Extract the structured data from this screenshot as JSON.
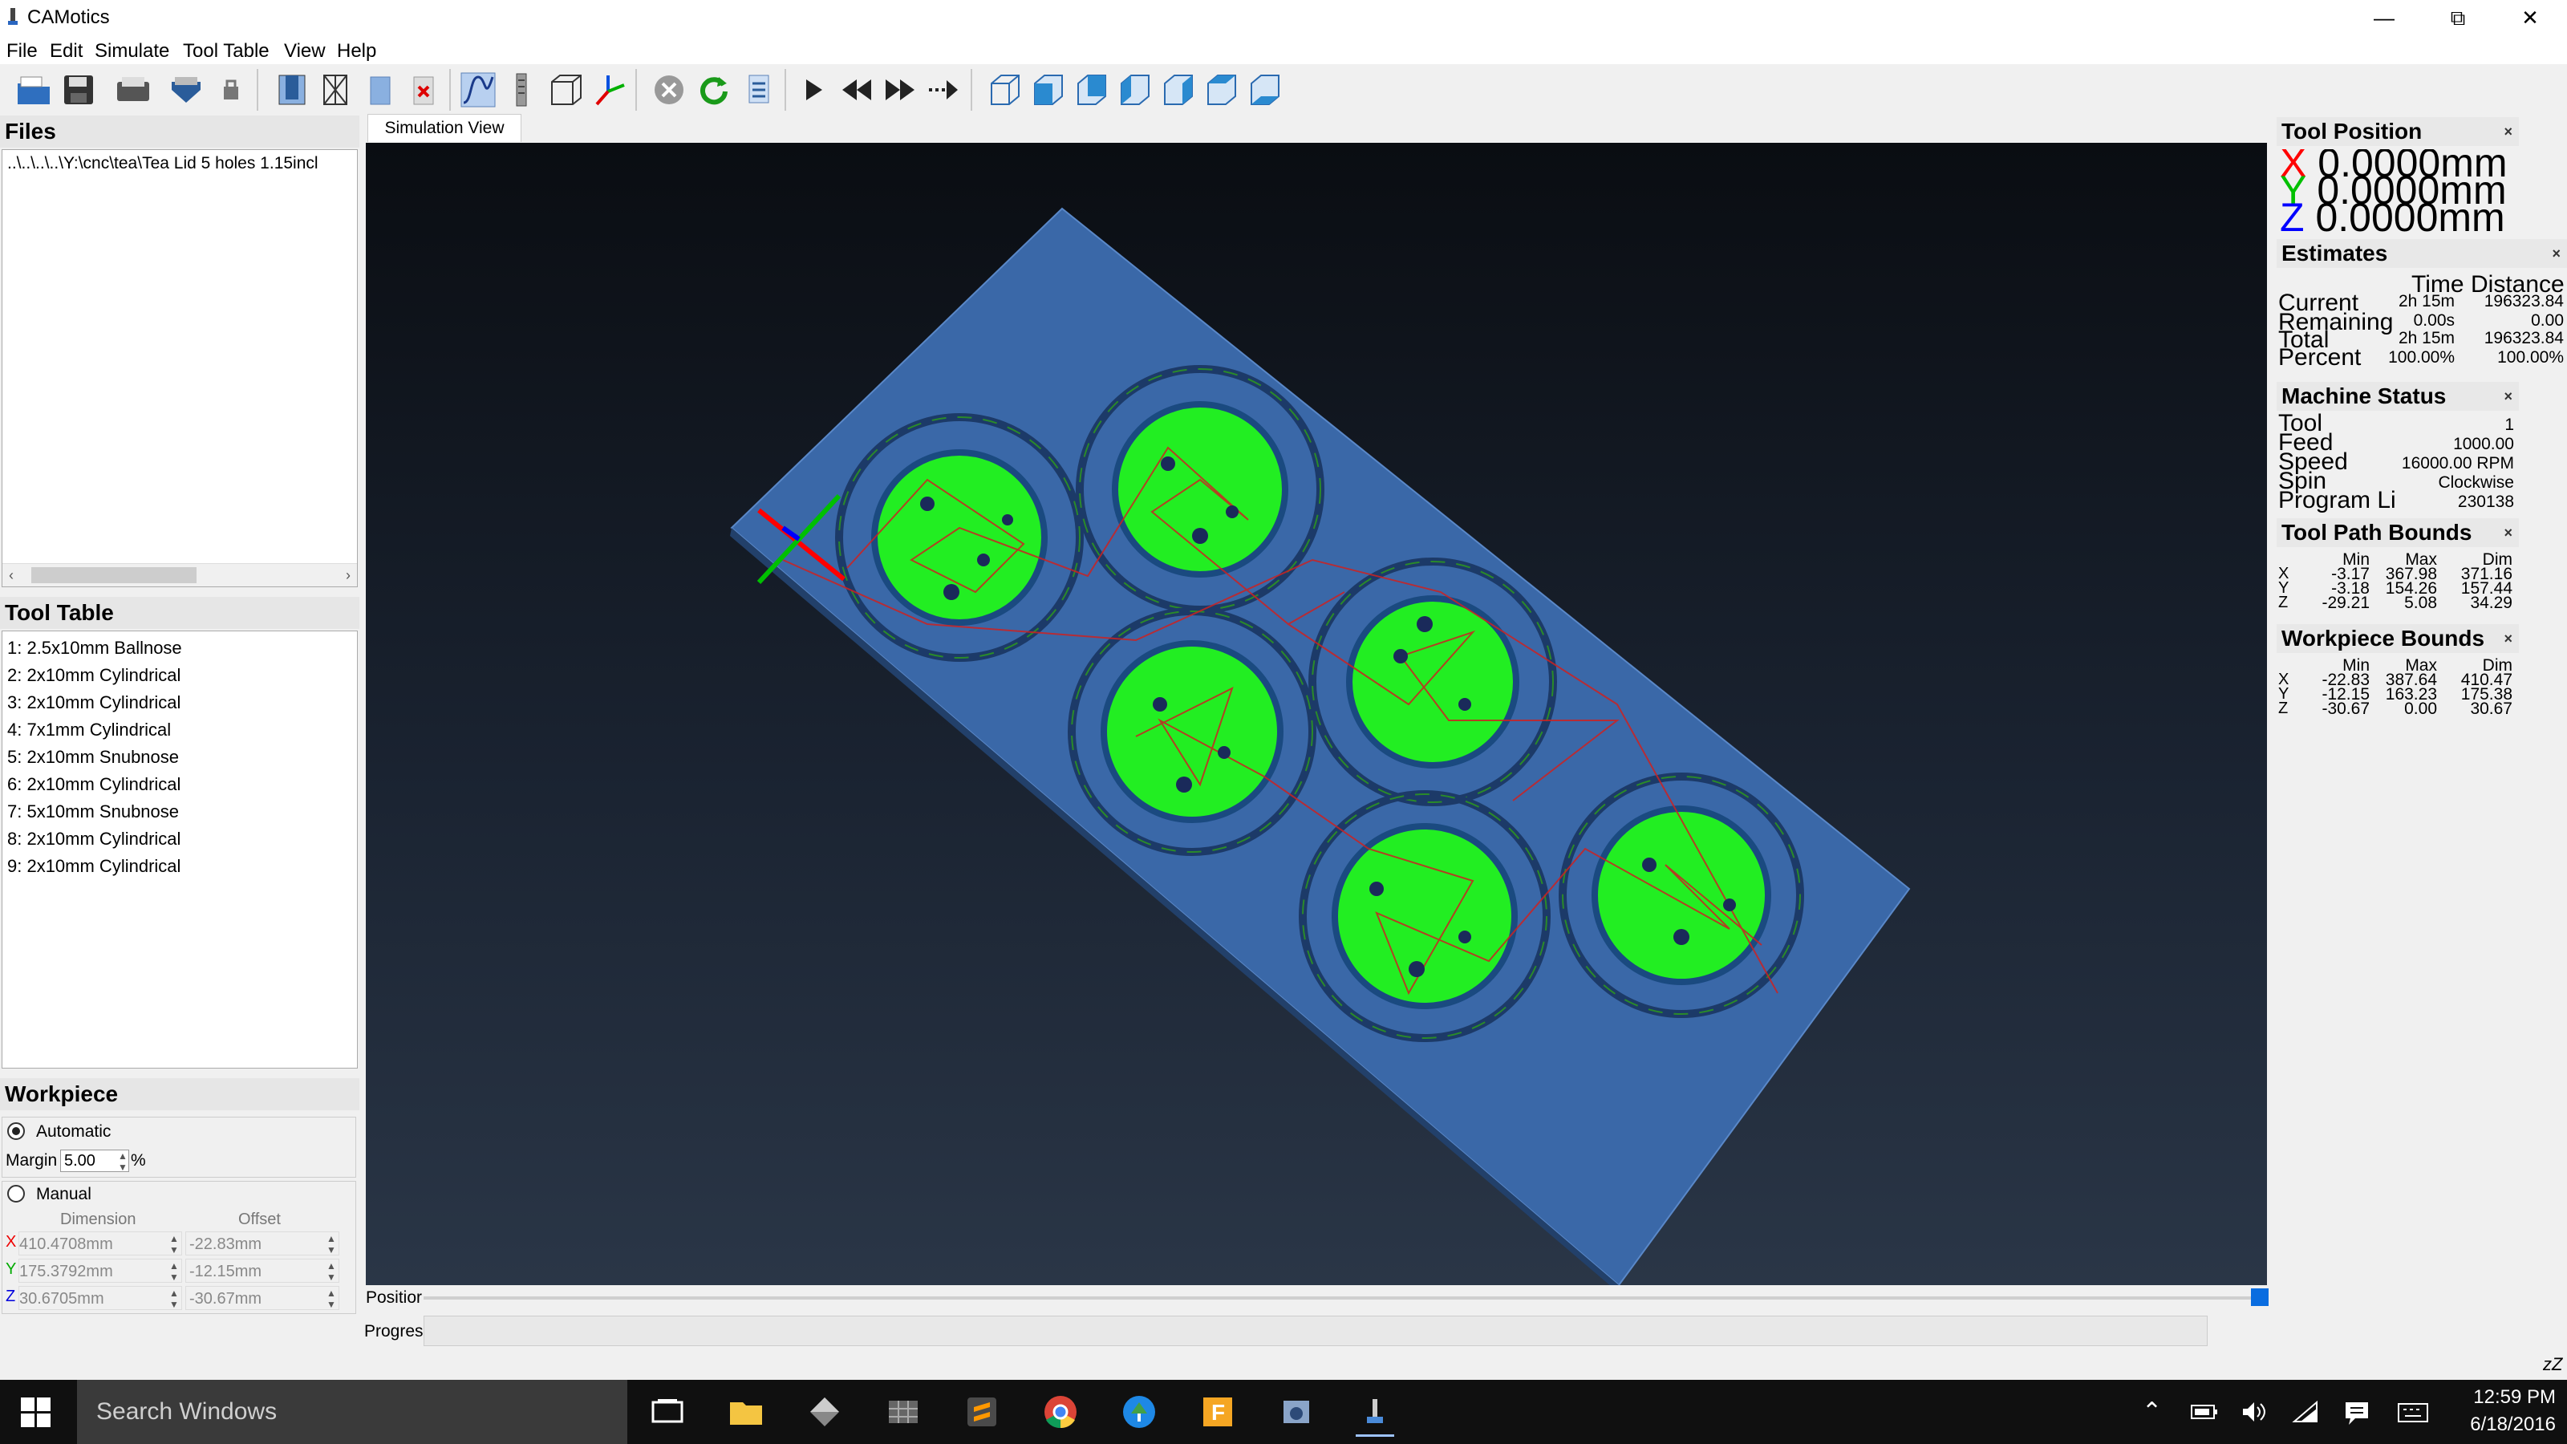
{
  "app": {
    "title": "CAMotics"
  },
  "menu": [
    "File",
    "Edit",
    "Simulate",
    "Tool Table",
    "View",
    "Help"
  ],
  "files": {
    "title": "Files",
    "items": [
      "..\\..\\..\\..\\Y:\\cnc\\tea\\Tea Lid 5 holes 1.15incl"
    ]
  },
  "tool_table": {
    "title": "Tool Table",
    "items": [
      "1: 2.5x10mm Ballnose",
      "2: 2x10mm Cylindrical",
      "3: 2x10mm Cylindrical",
      "4: 7x1mm Cylindrical",
      "5: 2x10mm Snubnose",
      "6: 2x10mm Cylindrical",
      "7: 5x10mm Snubnose",
      "8: 2x10mm Cylindrical",
      "9: 2x10mm Cylindrical"
    ]
  },
  "workpiece": {
    "title": "Workpiece",
    "automatic_label": "Automatic",
    "margin_label": "Margin",
    "margin_value": "5.00",
    "margin_unit": "%",
    "manual_label": "Manual",
    "dimension_header": "Dimension",
    "offset_header": "Offset",
    "rows": [
      {
        "axis": "X",
        "dimension": "410.4708mm",
        "offset": "-22.83mm"
      },
      {
        "axis": "Y",
        "dimension": "175.3792mm",
        "offset": "-12.15mm"
      },
      {
        "axis": "Z",
        "dimension": "30.6705mm",
        "offset": "-30.67mm"
      }
    ]
  },
  "simulation_tab": "Simulation View",
  "position_label": "Positior",
  "progress_label": "Progres",
  "tool_position": {
    "title": "Tool Position",
    "x": "0.0000mm",
    "y": "0.0000mm",
    "z": "0.0000mm"
  },
  "estimates": {
    "title": "Estimates",
    "col_time": "Time",
    "col_distance": "Distance",
    "rows": [
      {
        "label": "Current",
        "time": "2h 15m",
        "distance": "196323.84"
      },
      {
        "label": "Remaining",
        "time": "0.00s",
        "distance": "0.00"
      },
      {
        "label": "Total",
        "time": "2h 15m",
        "distance": "196323.84"
      },
      {
        "label": "Percent",
        "time": "100.00%",
        "distance": "100.00%"
      }
    ]
  },
  "machine_status": {
    "title": "Machine Status",
    "rows": [
      {
        "label": "Tool",
        "value": "1"
      },
      {
        "label": "Feed",
        "value": "1000.00"
      },
      {
        "label": "Speed",
        "value": "16000.00 RPM"
      },
      {
        "label": "Spin",
        "value": "Clockwise"
      },
      {
        "label": "Program Li",
        "value": "230138"
      }
    ]
  },
  "tool_path_bounds": {
    "title": "Tool Path Bounds",
    "headers": [
      "Min",
      "Max",
      "Dim"
    ],
    "rows": [
      {
        "axis": "X",
        "min": "-3.17",
        "max": "367.98",
        "dim": "371.16"
      },
      {
        "axis": "Y",
        "min": "-3.18",
        "max": "154.26",
        "dim": "157.44"
      },
      {
        "axis": "Z",
        "min": "-29.21",
        "max": "5.08",
        "dim": "34.29"
      }
    ]
  },
  "workpiece_bounds": {
    "title": "Workpiece Bounds",
    "headers": [
      "Min",
      "Max",
      "Dim"
    ],
    "rows": [
      {
        "axis": "X",
        "min": "-22.83",
        "max": "387.64",
        "dim": "410.47"
      },
      {
        "axis": "Y",
        "min": "-12.15",
        "max": "163.23",
        "dim": "175.38"
      },
      {
        "axis": "Z",
        "min": "-30.67",
        "max": "0.00",
        "dim": "30.67"
      }
    ]
  },
  "taskbar": {
    "search_placeholder": "Search Windows",
    "time": "12:59 PM",
    "date": "6/18/2016"
  },
  "colors": {
    "workpiece": "#3a68a8",
    "cut_pocket": "#22ee22",
    "toolpath": "#cc2222",
    "axis_x": "#ff0000",
    "axis_y": "#00c000",
    "axis_z": "#0000ff"
  }
}
